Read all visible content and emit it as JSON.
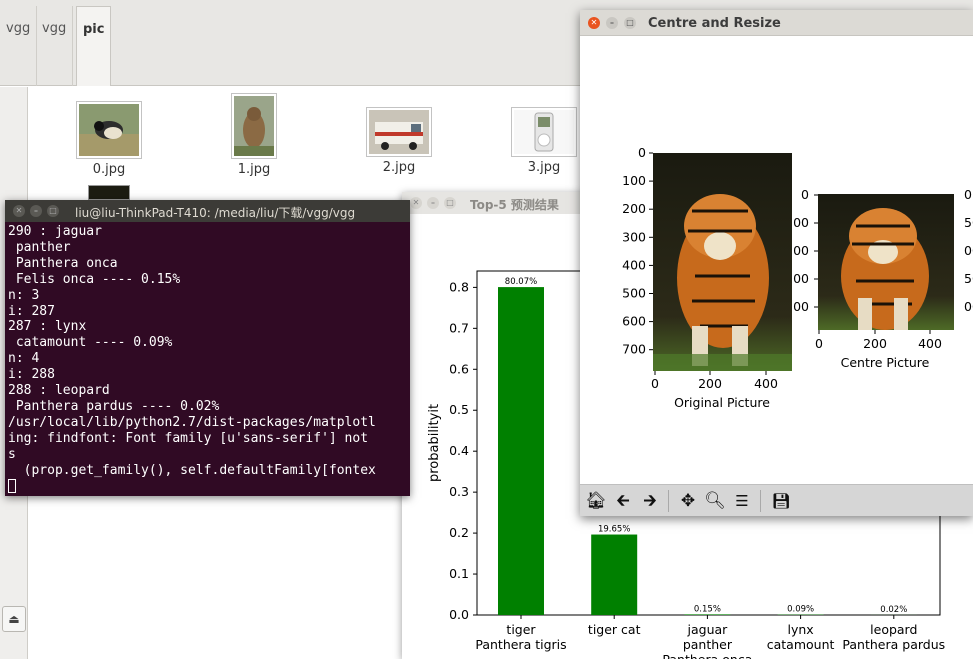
{
  "file_manager": {
    "path_buttons": [
      "vgg",
      "vgg",
      "pic"
    ],
    "files": [
      {
        "name": "0.jpg",
        "icon": "bird-thumbnail"
      },
      {
        "name": "1.jpg",
        "icon": "marmot-thumbnail"
      },
      {
        "name": "2.jpg",
        "icon": "ambulance-thumbnail"
      },
      {
        "name": "3.jpg",
        "icon": "ipod-thumbnail"
      }
    ]
  },
  "terminal": {
    "title": "liu@liu-ThinkPad-T410: /media/liu/下载/vgg/vgg",
    "lines": [
      "290 : jaguar",
      " panther",
      " Panthera onca",
      " Felis onca ---- 0.15%",
      "n: 3",
      "i: 287",
      "287 : lynx",
      " catamount ---- 0.09%",
      "n: 4",
      "i: 288",
      "288 : leopard",
      " Panthera pardus ---- 0.02%",
      "/usr/local/lib/python2.7/dist-packages/matplotl",
      "ing: findfont: Font family [u'sans-serif'] not",
      "s",
      "  (prop.get_family(), self.defaultFamily[fontex"
    ]
  },
  "chart_window": {
    "title": "Top-5 预测结果"
  },
  "chart_data": {
    "type": "bar",
    "categories": [
      "tiger\nPanthera tigris",
      "tiger cat",
      "jaguar\npanther\nPanthera onca",
      "lynx\ncatamount",
      "leopard\nPanthera pardus"
    ],
    "values": [
      0.8007,
      0.1965,
      0.0015,
      0.0009,
      0.0002
    ],
    "data_labels": [
      "80.07%",
      "19.65%",
      "0.15%",
      "0.09%",
      "0.02%"
    ],
    "ylabel": "probabilityit",
    "yticks": [
      "0.0",
      "0.1",
      "0.2",
      "0.3",
      "0.4",
      "0.5",
      "0.6",
      "0.7",
      "0.8"
    ],
    "ylim": [
      0,
      0.84
    ],
    "color": "#008000"
  },
  "centre_window": {
    "title": "Centre and Resize",
    "original_caption": "Original Picture",
    "centre_caption": "Centre Picture",
    "original_yticks": [
      "0",
      "100",
      "200",
      "300",
      "400",
      "500",
      "600",
      "700"
    ],
    "original_xticks": [
      "0",
      "200",
      "400"
    ],
    "centre_yticks_left": [
      "0",
      "00",
      "00",
      "00",
      "00"
    ],
    "centre_yticks_right": [
      "0",
      "50",
      "00",
      "50",
      "00"
    ],
    "centre_xticks": [
      "0",
      "200",
      "400"
    ],
    "toolbar": [
      "home-icon",
      "back-arrow-icon",
      "forward-arrow-icon",
      "pan-icon",
      "zoom-icon",
      "configure-subplots-icon",
      "save-icon"
    ]
  }
}
